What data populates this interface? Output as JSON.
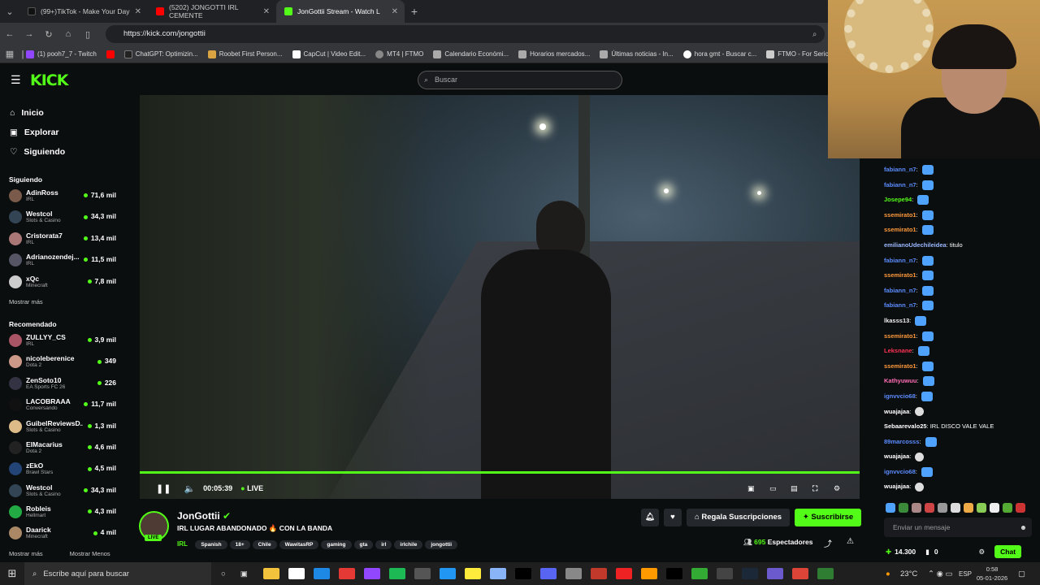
{
  "browser": {
    "tabs": [
      {
        "label": "(99+)TikTok - Make Your Day",
        "color": "#111"
      },
      {
        "label": "(5202) JONGOTTI IRL CEMENTE",
        "color": "#f00"
      },
      {
        "label": "JonGottii Stream - Watch L",
        "color": "#53fc18"
      }
    ],
    "url": "https://kick.com/jongottii",
    "bookmarks": [
      "(1) pooh7_7 - Twitch",
      "ChatGPT: Optimizin...",
      "Roobet First Person...",
      "CapCut | Video Edit...",
      "MT4 | FTMO",
      "Calendario Económi...",
      "Horarios mercados...",
      "Últimas noticias - In...",
      "hora gmt - Buscar c...",
      "FTMO - For Seriou"
    ]
  },
  "header": {
    "logo": "KICK",
    "search_placeholder": "Buscar"
  },
  "nav": {
    "home": "Inicio",
    "explore": "Explorar",
    "following": "Siguiendo"
  },
  "following": {
    "title": "Siguiendo",
    "more": "Mostrar más",
    "channels": [
      {
        "name": "AdinRoss",
        "cat": "IRL",
        "viewers": "71,6 mil",
        "color": "#7a5a4a"
      },
      {
        "name": "Westcol",
        "cat": "Slots & Casino",
        "viewers": "34,3 mil",
        "color": "#345"
      },
      {
        "name": "Cristorata7",
        "cat": "IRL",
        "viewers": "13,4 mil",
        "color": "#a77"
      },
      {
        "name": "Adrianozendej...",
        "cat": "IRL",
        "viewers": "11,5 mil",
        "color": "#556"
      },
      {
        "name": "xQc",
        "cat": "Minecraft",
        "viewers": "7,8 mil",
        "color": "#ccc"
      }
    ]
  },
  "recommended": {
    "title": "Recomendado",
    "more": "Mostrar más",
    "less": "Mostrar Menos",
    "channels": [
      {
        "name": "ZULLYY_CS",
        "cat": "IRL",
        "viewers": "3,9 mil",
        "color": "#a56"
      },
      {
        "name": "nicoleberenice",
        "cat": "Dota 2",
        "viewers": "349",
        "color": "#c98"
      },
      {
        "name": "ZenSoto10",
        "cat": "EA Sports FC 26",
        "viewers": "226",
        "color": "#334"
      },
      {
        "name": "LACOBRAAA",
        "cat": "Conversando",
        "viewers": "11,7 mil",
        "color": "#111"
      },
      {
        "name": "GuibelReviewsD...",
        "cat": "Slots & Casino",
        "viewers": "1,3 mil",
        "color": "#db8"
      },
      {
        "name": "ElMacarius",
        "cat": "Dota 2",
        "viewers": "4,6 mil",
        "color": "#222"
      },
      {
        "name": "zEkO",
        "cat": "Brawl Stars",
        "viewers": "4,5 mil",
        "color": "#247"
      },
      {
        "name": "Westcol",
        "cat": "Slots & Casino",
        "viewers": "34,3 mil",
        "color": "#345"
      },
      {
        "name": "Robleis",
        "cat": "Hellmart",
        "viewers": "4,3 mil",
        "color": "#2a4"
      },
      {
        "name": "Daarick",
        "cat": "Minecraft",
        "viewers": "4 mil",
        "color": "#a86"
      }
    ]
  },
  "player": {
    "time": "00:05:39",
    "live": "LIVE",
    "progress": 1.0
  },
  "stream": {
    "channel": "JonGottii",
    "title": "IRL LUGAR ABANDONADO 🔥 CON LA BANDA",
    "category": "IRL",
    "live_badge": "LIVE",
    "tags": [
      "Spanish",
      "18+",
      "Chile",
      "WawitasRP",
      "gaming",
      "gta",
      "irl",
      "irlchile",
      "jongottii"
    ],
    "viewers": "695",
    "viewers_label": "Espectadores",
    "gift": "Regala Suscripciones",
    "subscribe": "Suscribirse"
  },
  "chat": {
    "messages": [
      {
        "user": "fabiann_n7",
        "color": "#5b8cff",
        "text": ""
      },
      {
        "user": "fabiann_n7",
        "color": "#5b8cff",
        "text": ""
      },
      {
        "user": "Josepe94",
        "color": "#53fc18",
        "text": ""
      },
      {
        "user": "ssemirato1",
        "color": "#ff9a3d",
        "text": ""
      },
      {
        "user": "ssemirato1",
        "color": "#ff9a3d",
        "text": ""
      },
      {
        "user": "emilianoUdechileidea",
        "color": "#9cb8ff",
        "text": "titulo"
      },
      {
        "user": "fabiann_n7",
        "color": "#5b8cff",
        "text": ""
      },
      {
        "user": "ssemirato1",
        "color": "#ff9a3d",
        "text": ""
      },
      {
        "user": "fabiann_n7",
        "color": "#5b8cff",
        "text": ""
      },
      {
        "user": "fabiann_n7",
        "color": "#5b8cff",
        "text": ""
      },
      {
        "user": "lkasss13",
        "color": "#eee",
        "text": ""
      },
      {
        "user": "ssemirato1",
        "color": "#ff9a3d",
        "text": ""
      },
      {
        "user": "Leksnane",
        "color": "#ff3355",
        "text": ""
      },
      {
        "user": "ssemirato1",
        "color": "#ff9a3d",
        "text": ""
      },
      {
        "user": "Kathyuwuu",
        "color": "#ff6fb5",
        "text": ""
      },
      {
        "user": "ignvvcio68",
        "color": "#5b8cff",
        "text": ""
      },
      {
        "user": "wuajajaa",
        "color": "#fff",
        "text": ""
      },
      {
        "user": "Sebaarevalo25",
        "color": "#fff",
        "text": "IRL DISCO VALE VALE"
      },
      {
        "user": "89marcosss",
        "color": "#5b8cff",
        "text": ""
      },
      {
        "user": "wuajajaa",
        "color": "#fff",
        "text": ""
      },
      {
        "user": "ignvvcio68",
        "color": "#5b8cff",
        "text": ""
      },
      {
        "user": "wuajajaa",
        "color": "#fff",
        "text": ""
      }
    ],
    "placeholder": "Enviar un mensaje",
    "points": "14.300",
    "subs": "0",
    "chat_btn": "Chat"
  },
  "taskbar": {
    "search": "Escribe aquí para buscar",
    "weather": "23°C",
    "lang": "ESP",
    "time": "0:58",
    "date": "05-01-2026"
  }
}
